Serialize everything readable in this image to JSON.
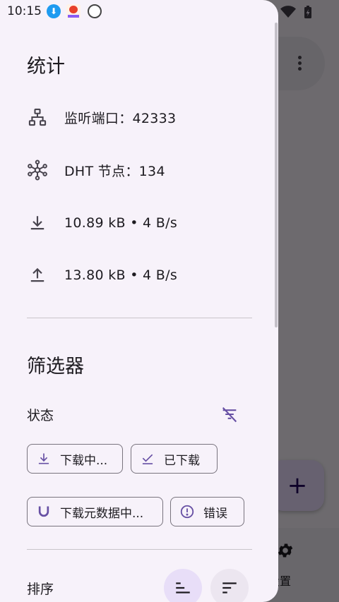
{
  "status_bar": {
    "time": "10:15"
  },
  "drawer": {
    "stats": {
      "title": "统计",
      "listen_port": "监听端口：42333",
      "dht_nodes": "DHT 节点：134",
      "download": "10.89 kB • 4 B/s",
      "upload": "13.80 kB • 4 B/s"
    },
    "filters": {
      "title": "筛选器",
      "status_label": "状态",
      "chips": [
        {
          "label": "下载中...",
          "icon": "download-icon"
        },
        {
          "label": "已下载",
          "icon": "check-icon"
        },
        {
          "label": "下载元数据中...",
          "icon": "magnet-icon"
        },
        {
          "label": "错误",
          "icon": "error-icon"
        }
      ]
    },
    "sort": {
      "label": "排序"
    }
  },
  "background": {
    "fab_label": "+",
    "nav_settings_label": "设置"
  },
  "colors": {
    "accent": "#6750a4",
    "icon": "#49454f",
    "surface": "#f7f2fa"
  }
}
